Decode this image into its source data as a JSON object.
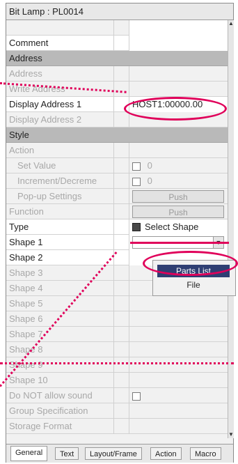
{
  "panel": {
    "title": "Bit Lamp : PL0014"
  },
  "rows": [
    {
      "label": "",
      "value": "",
      "type": "header"
    },
    {
      "label": "Comment",
      "value": "",
      "type": "normal"
    },
    {
      "label": "Address",
      "value": "",
      "type": "section"
    },
    {
      "label": "Address",
      "value": "",
      "type": "disabled"
    },
    {
      "label": "Write Address",
      "value": "",
      "type": "disabled"
    },
    {
      "label": "Display Address 1",
      "value": "HOST1:00000.00",
      "type": "normal"
    },
    {
      "label": "Display Address 2",
      "value": "",
      "type": "disabled"
    },
    {
      "label": "Style",
      "value": "",
      "type": "section"
    },
    {
      "label": "Action",
      "value": "",
      "type": "disabled"
    },
    {
      "label": "Set Value",
      "value": "0",
      "type": "disabled-check"
    },
    {
      "label": "Increment/Decreme",
      "value": "0",
      "type": "disabled-check"
    },
    {
      "label": "Pop-up Settings",
      "value": "Push",
      "type": "disabled-button"
    },
    {
      "label": "Function",
      "value": "Push",
      "type": "disabled-button"
    },
    {
      "label": "Type",
      "value": "Select Shape",
      "type": "select"
    },
    {
      "label": "Shape 1",
      "value": "",
      "type": "combo"
    },
    {
      "label": "Shape 2",
      "value": "",
      "type": "normal"
    },
    {
      "label": "Shape 3",
      "value": "",
      "type": "disabled"
    },
    {
      "label": "Shape 4",
      "value": "",
      "type": "disabled"
    },
    {
      "label": "Shape 5",
      "value": "",
      "type": "disabled"
    },
    {
      "label": "Shape 6",
      "value": "",
      "type": "disabled"
    },
    {
      "label": "Shape 7",
      "value": "",
      "type": "disabled"
    },
    {
      "label": "Shape 8",
      "value": "",
      "type": "disabled"
    },
    {
      "label": "Shape 9",
      "value": "",
      "type": "disabled"
    },
    {
      "label": "Shape 10",
      "value": "",
      "type": "disabled"
    },
    {
      "label": "Do NOT allow sound",
      "value": "",
      "type": "disabled-check-right"
    },
    {
      "label": "Group Specification",
      "value": "",
      "type": "disabled"
    },
    {
      "label": "Storage Format",
      "value": "",
      "type": "disabled"
    }
  ],
  "dropdown": {
    "selected": "Parts List",
    "second": "File"
  },
  "tabs": [
    "General",
    "Text",
    "Layout/Frame",
    "Action",
    "Macro"
  ],
  "colors": {
    "annotation": "#e0005a",
    "section_bg": "#b9b9b9",
    "dropdown_selected_bg": "#2f3f73"
  }
}
